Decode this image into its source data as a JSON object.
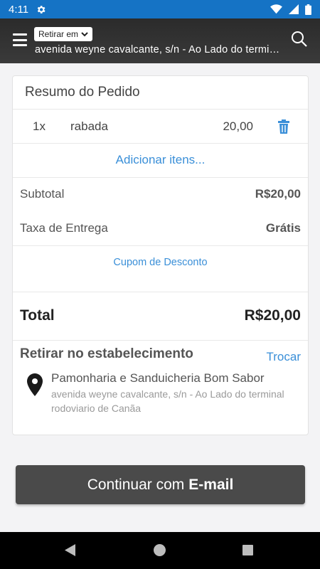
{
  "status_bar": {
    "time": "4:11",
    "icons": [
      "gear-icon",
      "wifi-icon",
      "signal-icon",
      "battery-icon"
    ]
  },
  "header": {
    "pickup_select": "Retirar em",
    "address": "avenida weyne cavalcante, s/n - Ao Lado do terminal rodoviario de Canãa",
    "icons": [
      "menu-icon",
      "chevron-down-icon",
      "search-icon"
    ]
  },
  "order": {
    "title": "Resumo do Pedido",
    "items": [
      {
        "qty": "1x",
        "name": "rabada",
        "price": "20,00"
      }
    ],
    "add_items": "Adicionar itens...",
    "subtotal_label": "Subtotal",
    "subtotal_value": "R$20,00",
    "delivery_label": "Taxa de Entrega",
    "delivery_value": "Grátis",
    "coupon": "Cupom de Desconto",
    "total_label": "Total",
    "total_value": "R$20,00"
  },
  "pickup": {
    "title": "Retirar no estabelecimento",
    "swap": "Trocar",
    "store_name": "Pamonharia e Sanduicheria Bom Sabor",
    "store_address": "avenida weyne cavalcante, s/n - Ao Lado do terminal rodoviario de Canãa"
  },
  "continue_button": {
    "prefix": "Continuar com",
    "method": "E-mail"
  },
  "colors": {
    "status_bar": "#1573c5",
    "link": "#3a8fd8",
    "button": "#4a4a4a"
  }
}
